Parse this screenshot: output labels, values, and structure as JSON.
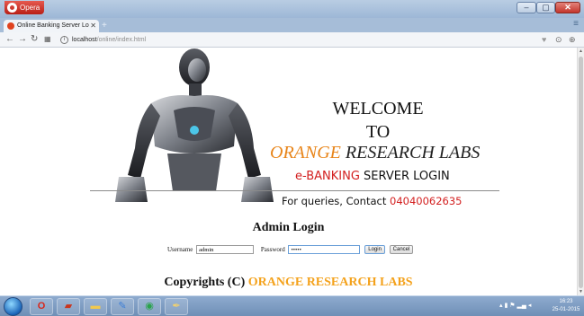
{
  "browser": {
    "menu_label": "Opera",
    "tab_title": "Online Banking Server Lo",
    "tab_close": "✕",
    "new_tab": "+",
    "address_host": "localhost",
    "address_path": "/online/index.html",
    "window_controls": {
      "minimize": "–",
      "maximize": "▢",
      "close": "✕"
    }
  },
  "page": {
    "welcome_line1": "WELCOME",
    "welcome_line2": "TO",
    "company_highlight": "ORANGE",
    "company_rest": " RESEARCH LABS",
    "ebanking_highlight": "e-BANKING",
    "ebanking_rest": " SERVER LOGIN",
    "queries_text": "For queries, Contact ",
    "queries_phone": "04040062635",
    "admin_title": "Admin Login",
    "form": {
      "username_label": "Username",
      "username_value": "admin",
      "password_label": "Password",
      "password_value": "•••••",
      "login_button": "Login",
      "cancel_button": "Cancel"
    },
    "copyright_prefix": "Copyrights (C) ",
    "copyright_company": "ORANGE RESEARCH LABS"
  },
  "taskbar": {
    "clock_time": "16:23",
    "clock_date": "25-01-2015"
  },
  "colors": {
    "orange_text": "#e8851a",
    "red_text": "#d31f1f",
    "copyright_orange": "#f4a21c",
    "os_frame_blue": "#9db7d6"
  }
}
